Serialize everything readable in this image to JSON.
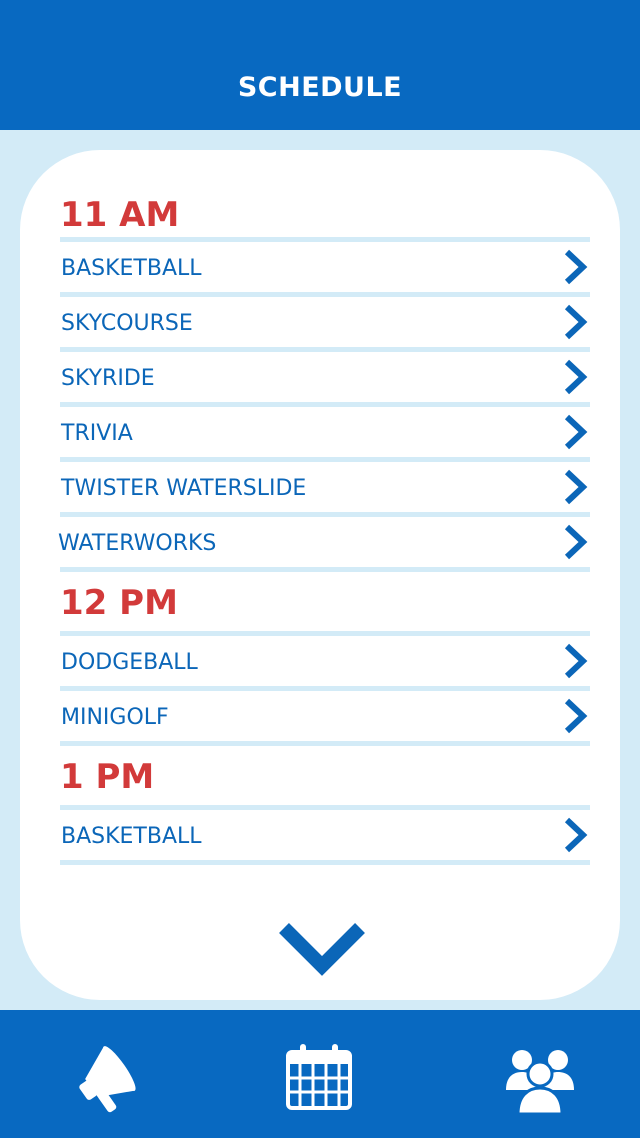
{
  "header": {
    "title": "SCHEDULE"
  },
  "colors": {
    "brand": "#0869c1",
    "background": "#d3ebf7",
    "time": "#d23a3a",
    "item": "#0b66b8"
  },
  "schedule": [
    {
      "time": "11 AM",
      "items": [
        {
          "label": "BASKETBALL"
        },
        {
          "label": "SKYCOURSE"
        },
        {
          "label": "SKYRIDE"
        },
        {
          "label": "TRIVIA"
        },
        {
          "label": "TWISTER WATERSLIDE"
        },
        {
          "label": "WATERWORKS"
        }
      ]
    },
    {
      "time": "12 PM",
      "items": [
        {
          "label": "DODGEBALL"
        },
        {
          "label": "MINIGOLF"
        }
      ]
    },
    {
      "time": "1 PM",
      "items": [
        {
          "label": "BASKETBALL"
        }
      ]
    }
  ],
  "icons": {
    "row": "chevron-right-icon",
    "more": "chevron-down-icon",
    "tabs": [
      "megaphone-icon",
      "calendar-icon",
      "group-icon"
    ]
  }
}
